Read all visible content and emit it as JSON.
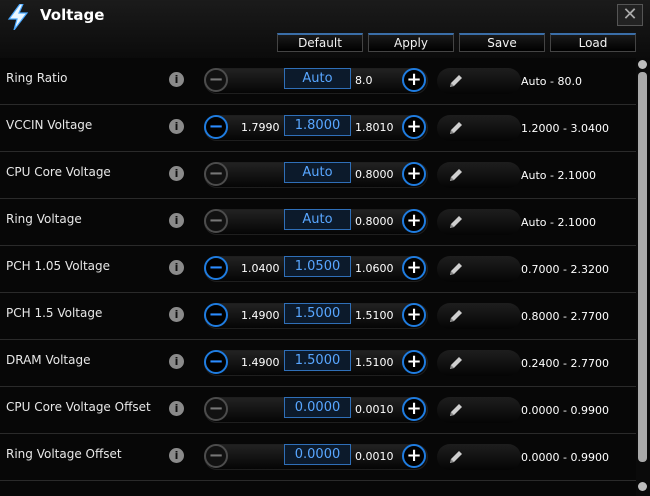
{
  "window": {
    "title": "Voltage",
    "close_glyph": "✕"
  },
  "toolbar": {
    "default_label": "Default",
    "apply_label": "Apply",
    "save_label": "Save",
    "load_label": "Load"
  },
  "rows": [
    {
      "label": "Ring Ratio",
      "info": "i",
      "min": "",
      "value": "Auto",
      "max": "8.0",
      "range": "Auto - 80.0",
      "minus_active": false
    },
    {
      "label": "VCCIN Voltage",
      "info": "i",
      "min": "1.7990",
      "value": "1.8000",
      "max": "1.8010",
      "range": "1.2000 - 3.0400",
      "minus_active": true
    },
    {
      "label": "CPU Core Voltage",
      "info": "i",
      "min": "",
      "value": "Auto",
      "max": "0.8000",
      "range": "Auto - 2.1000",
      "minus_active": false
    },
    {
      "label": "Ring Voltage",
      "info": "i",
      "min": "",
      "value": "Auto",
      "max": "0.8000",
      "range": "Auto - 2.1000",
      "minus_active": false
    },
    {
      "label": "PCH 1.05 Voltage",
      "info": "i",
      "min": "1.0400",
      "value": "1.0500",
      "max": "1.0600",
      "range": "0.7000 - 2.3200",
      "minus_active": true
    },
    {
      "label": "PCH 1.5 Voltage",
      "info": "i",
      "min": "1.4900",
      "value": "1.5000",
      "max": "1.5100",
      "range": "0.8000 - 2.7700",
      "minus_active": true
    },
    {
      "label": "DRAM Voltage",
      "info": "i",
      "min": "1.4900",
      "value": "1.5000",
      "max": "1.5100",
      "range": "0.2400 - 2.7700",
      "minus_active": true
    },
    {
      "label": "CPU Core Voltage Offset",
      "info": "i",
      "min": "",
      "value": "0.0000",
      "max": "0.0010",
      "range": "0.0000 - 0.9900",
      "minus_active": false
    },
    {
      "label": "Ring Voltage Offset",
      "info": "i",
      "min": "",
      "value": "0.0000",
      "max": "0.0010",
      "range": "0.0000 - 0.9900",
      "minus_active": false
    }
  ],
  "icons": {
    "title": "lightning-icon",
    "info": "info-icon",
    "minus": "minus-icon",
    "plus": "plus-icon",
    "edit": "pencil-icon"
  },
  "colors": {
    "accent": "#1f7ce0",
    "value_text": "#58a6ff"
  }
}
